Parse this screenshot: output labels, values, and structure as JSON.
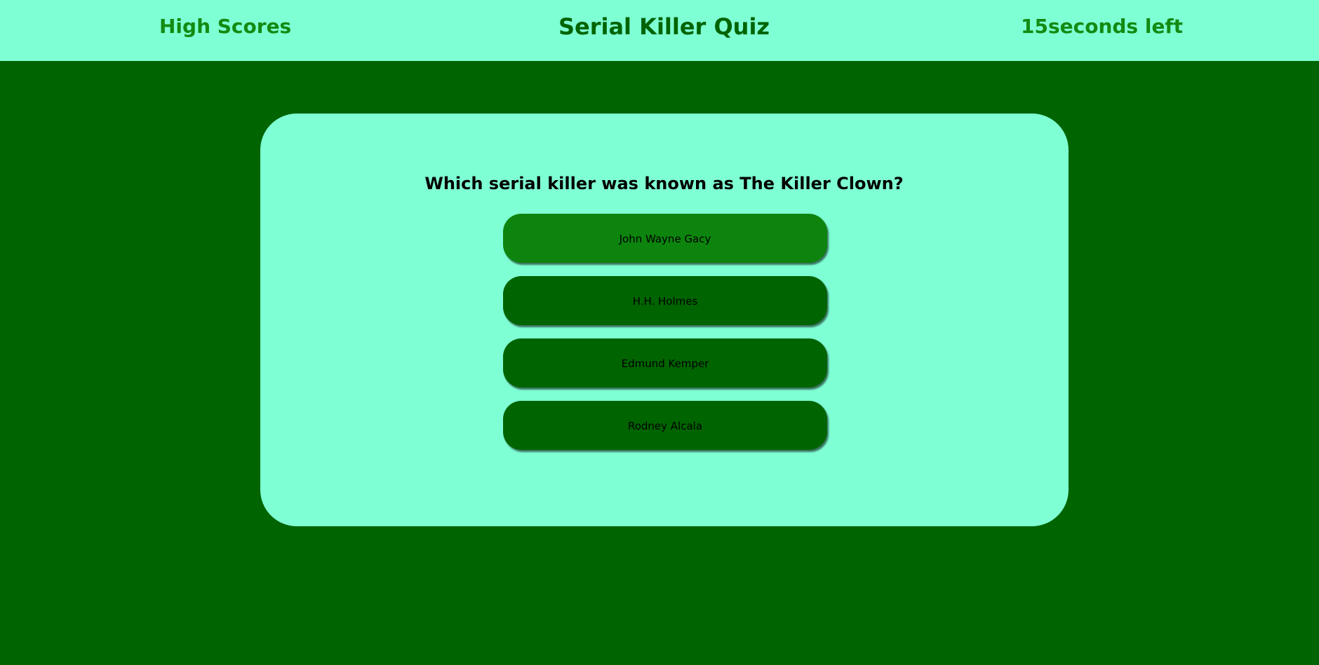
{
  "header": {
    "high_scores_label": "High Scores",
    "title": "Serial Killer Quiz",
    "timer_text": "15seconds left"
  },
  "quiz": {
    "question": "Which serial killer was known as The Killer Clown?",
    "answers": [
      {
        "label": "John Wayne Gacy"
      },
      {
        "label": "H.H. Holmes"
      },
      {
        "label": "Edmund Kemper"
      },
      {
        "label": "Rodney Alcala"
      }
    ]
  },
  "colors": {
    "background": "#006400",
    "panel": "#7fffd4",
    "button": "#006400",
    "button_hover": "#0d840d",
    "header_text": "#128b12"
  }
}
